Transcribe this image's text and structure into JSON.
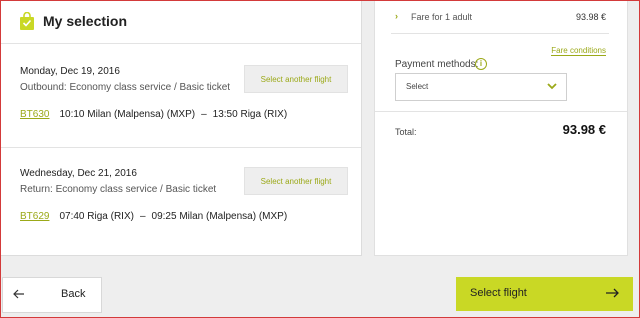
{
  "header": {
    "title": "My selection",
    "icon": "shopping-bag-icon"
  },
  "flights": [
    {
      "date": "Monday, Dec 19, 2016",
      "service": "Outbound: Economy class service / Basic ticket",
      "code": "BT630",
      "depart_time": "10:10",
      "depart_place": "Milan (Malpensa) (MXP)",
      "arrive_time": "13:50",
      "arrive_place": "Riga (RIX)",
      "action_label": "Select another flight"
    },
    {
      "date": "Wednesday, Dec 21, 2016",
      "service": "Return: Economy class service / Basic ticket",
      "code": "BT629",
      "depart_time": "07:40",
      "depart_place": "Riga (RIX)",
      "arrive_time": "09:25",
      "arrive_place": "Milan (Malpensa) (MXP)",
      "action_label": "Select another flight"
    }
  ],
  "fare": {
    "label": "Fare for 1 adult",
    "value": "93.98 €",
    "conditions_link": "Fare conditions"
  },
  "payment": {
    "label": "Payment methods:",
    "selected": "Select"
  },
  "total": {
    "label": "Total:",
    "value": "93.98 €"
  },
  "footer": {
    "back_label": "Back",
    "select_label": "Select flight"
  },
  "colors": {
    "accent": "#c9d825",
    "link": "#9ba918"
  }
}
